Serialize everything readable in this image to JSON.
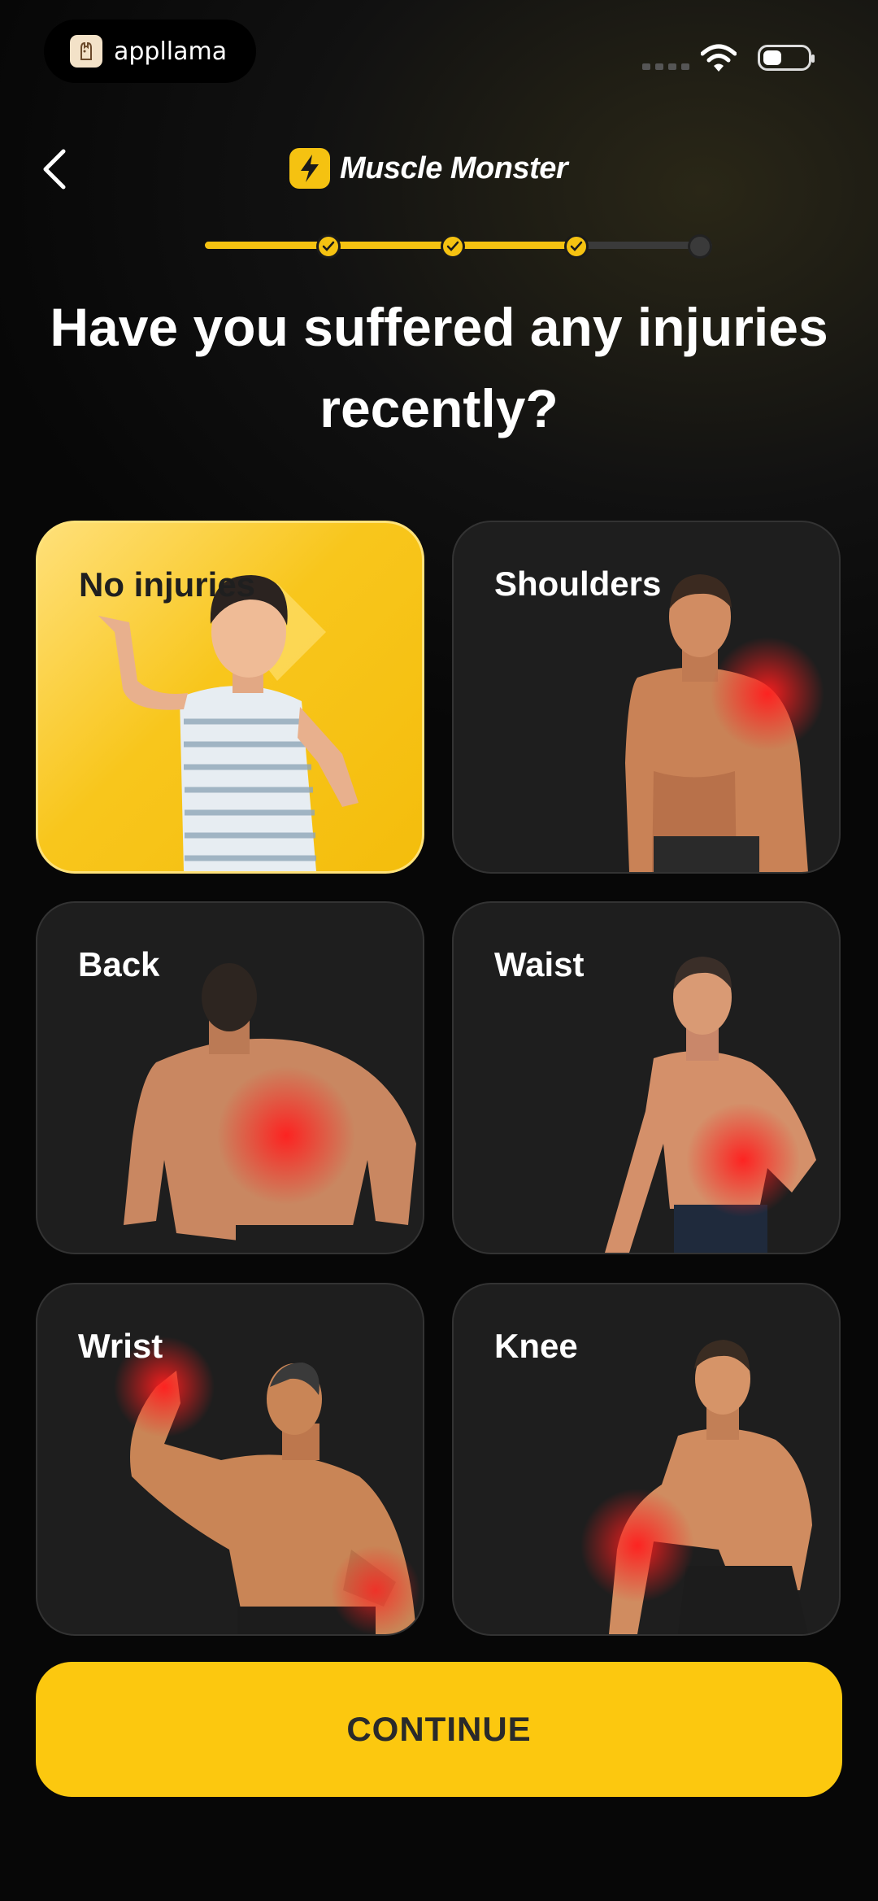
{
  "status_bar": {
    "app_name": "appllama"
  },
  "header": {
    "brand": "Muscle Monster"
  },
  "progress": {
    "completed_steps": 3,
    "total_steps": 4
  },
  "question": "Have you suffered any injuries recently?",
  "options": [
    {
      "label": "No injuries",
      "selected": true
    },
    {
      "label": "Shoulders",
      "selected": false
    },
    {
      "label": "Back",
      "selected": false
    },
    {
      "label": "Waist",
      "selected": false
    },
    {
      "label": "Wrist",
      "selected": false
    },
    {
      "label": "Knee",
      "selected": false
    }
  ],
  "continue_label": "CONTINUE",
  "colors": {
    "accent": "#FCC80F",
    "card": "#1E1E1E",
    "injury": "#FF1E1E"
  },
  "icons": [
    "appllama-icon",
    "wifi-icon",
    "battery-icon",
    "back-icon",
    "lightning-icon",
    "checkmark-icon"
  ]
}
